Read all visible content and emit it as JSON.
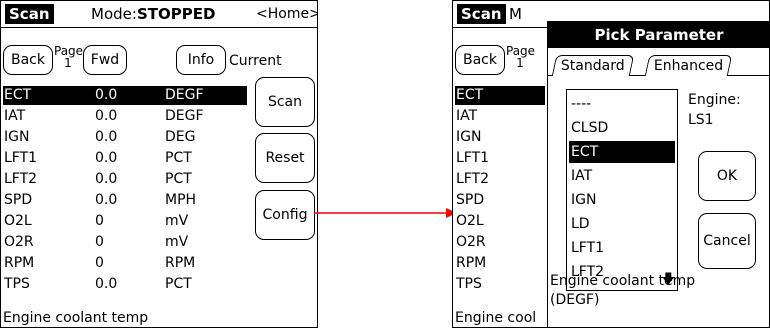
{
  "left_screen": {
    "title_tag": "Scan",
    "mode_label": "Mode:",
    "mode_value": "STOPPED",
    "home_link": "<Home>",
    "back_button": "Back",
    "page_label": "Page",
    "page_number": "1",
    "fwd_button": "Fwd",
    "info_button": "Info",
    "current_label": "Current",
    "scan_button": "Scan",
    "reset_button": "Reset",
    "config_button": "Config",
    "rows": [
      {
        "name": "ECT",
        "value": "0.0",
        "unit": "DEGF"
      },
      {
        "name": "IAT",
        "value": "0.0",
        "unit": "DEGF"
      },
      {
        "name": "IGN",
        "value": "0.0",
        "unit": "DEG"
      },
      {
        "name": "LFT1",
        "value": "0.0",
        "unit": "PCT"
      },
      {
        "name": "LFT2",
        "value": "0.0",
        "unit": "PCT"
      },
      {
        "name": "SPD",
        "value": "0.0",
        "unit": "MPH"
      },
      {
        "name": "O2L",
        "value": "0",
        "unit": "mV"
      },
      {
        "name": "O2R",
        "value": "0",
        "unit": "mV"
      },
      {
        "name": "RPM",
        "value": "0",
        "unit": "RPM"
      },
      {
        "name": "TPS",
        "value": "0.0",
        "unit": "PCT"
      }
    ],
    "status_text": "Engine coolant temp"
  },
  "right_screen": {
    "title_tag": "Scan",
    "mode_label_partial": "M",
    "back_button": "Back",
    "page_label": "Page",
    "page_number": "1",
    "rows": [
      "ECT",
      "IAT",
      "IGN",
      "LFT1",
      "LFT2",
      "SPD",
      "O2L",
      "O2R",
      "RPM",
      "TPS"
    ],
    "status_text_partial": "Engine cool",
    "dialog": {
      "title": "Pick Parameter",
      "tabs": [
        "Standard",
        "Enhanced"
      ],
      "list_items": [
        "----",
        "CLSD",
        "ECT",
        "IAT",
        "IGN",
        "LD",
        "LFT1",
        "LFT2"
      ],
      "selected_item": "ECT",
      "engine_label": "Engine:",
      "engine_value": "LS1",
      "ok_button": "OK",
      "cancel_button": "Cancel",
      "description_line1": "Engine coolant temp",
      "description_line2": "(DEGF)"
    }
  },
  "colors": {
    "arrow": "#ff0000",
    "selection": "#000000",
    "background": "#ffffff"
  },
  "icons": {
    "scroll_down": "down-arrow-icon"
  }
}
